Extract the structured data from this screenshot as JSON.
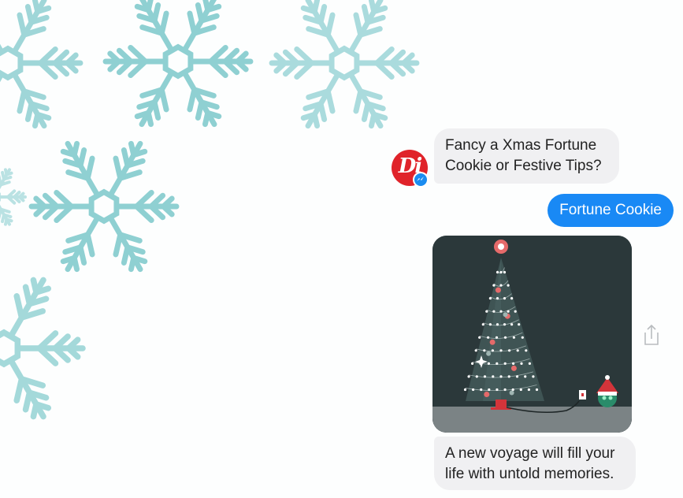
{
  "chat": {
    "avatar_letters": "Di",
    "messages": [
      {
        "from": "bot",
        "text_line1": "Fancy a Xmas Fortune",
        "text_line2": "Cookie or Festive Tips?"
      },
      {
        "from": "user",
        "text": "Fortune Cookie"
      },
      {
        "from": "bot",
        "text_line1": "A new voyage will fill your",
        "text_line2": "life with untold memories."
      }
    ]
  },
  "colors": {
    "snowflake": "#8fd0d2",
    "user_bubble": "#1989f5",
    "bot_bubble": "#f0f0f2",
    "avatar": "#e0232a",
    "card_background": "#2b383a",
    "card_floor": "#7b8385"
  },
  "icons": {
    "share": "share-icon",
    "messenger_badge": "messenger-badge-icon"
  }
}
